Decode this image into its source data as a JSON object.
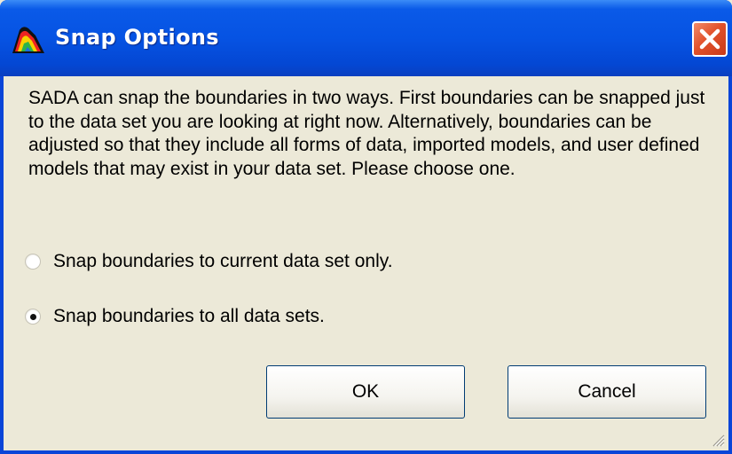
{
  "window": {
    "title": "Snap Options",
    "app_icon": "sada-app-icon",
    "close_icon": "close-icon"
  },
  "dialog": {
    "message": "SADA can snap the boundaries in two ways. First boundaries can be snapped just to the data set you are looking at right now. Alternatively, boundaries can be adjusted so that they include all forms of data, imported models, and user defined models that may exist in your data set. Please choose one.",
    "options": [
      {
        "label": "Snap boundaries to current data set only.",
        "checked": false
      },
      {
        "label": "Snap boundaries to all data sets.",
        "checked": true
      }
    ],
    "ok_label": "OK",
    "cancel_label": "Cancel"
  },
  "colors": {
    "titlebar": "#0653e3",
    "close_button": "#e2522b",
    "dialog_bg": "#ece9d8",
    "button_border": "#003c74"
  }
}
